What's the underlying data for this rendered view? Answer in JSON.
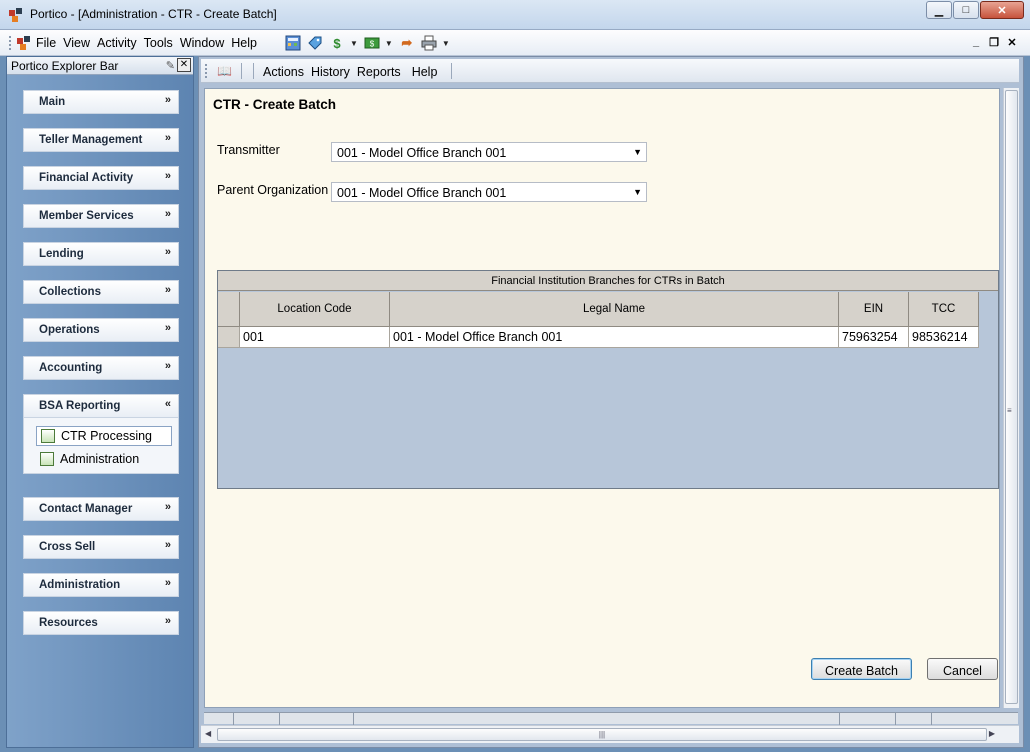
{
  "window": {
    "title": "Portico - [Administration - CTR - Create Batch]",
    "minimize": "▁",
    "maximize": "□",
    "close": "✕"
  },
  "menubar": {
    "items": [
      "File",
      "View",
      "Activity",
      "Tools",
      "Window",
      "Help"
    ],
    "mdi_minimize": "_",
    "mdi_restore": "❐",
    "mdi_close": "✕"
  },
  "explorer": {
    "title": "Portico Explorer Bar",
    "groups": [
      {
        "label": "Main",
        "chevron": "»"
      },
      {
        "label": "Teller Management",
        "chevron": "»"
      },
      {
        "label": "Financial Activity",
        "chevron": "»"
      },
      {
        "label": "Member Services",
        "chevron": "»"
      },
      {
        "label": "Lending",
        "chevron": "»"
      },
      {
        "label": "Collections",
        "chevron": "»"
      },
      {
        "label": "Operations",
        "chevron": "»"
      },
      {
        "label": "Accounting",
        "chevron": "»"
      },
      {
        "label": "BSA Reporting",
        "chevron": "«"
      },
      {
        "label": "Contact Manager",
        "chevron": "»"
      },
      {
        "label": "Cross Sell",
        "chevron": "»"
      },
      {
        "label": "Administration",
        "chevron": "»"
      },
      {
        "label": "Resources",
        "chevron": "»"
      }
    ],
    "tasks": [
      "CTR Processing",
      "Administration"
    ]
  },
  "toolbar": {
    "items": [
      "Actions",
      "History",
      "Reports",
      "Help"
    ]
  },
  "page": {
    "title": "CTR - Create Batch",
    "transmitter_label": "Transmitter",
    "transmitter_value": "001 - Model Office Branch 001",
    "parent_label": "Parent Organization",
    "parent_value": "001 - Model Office Branch 001"
  },
  "grid": {
    "caption": "Financial Institution Branches for CTRs in Batch",
    "columns": [
      "Location Code",
      "Legal Name",
      "EIN",
      "TCC"
    ],
    "rows": [
      [
        "001",
        "001 - Model Office Branch 001",
        "75963254",
        "98536214"
      ]
    ]
  },
  "buttons": {
    "create": "Create Batch",
    "cancel": "Cancel"
  }
}
